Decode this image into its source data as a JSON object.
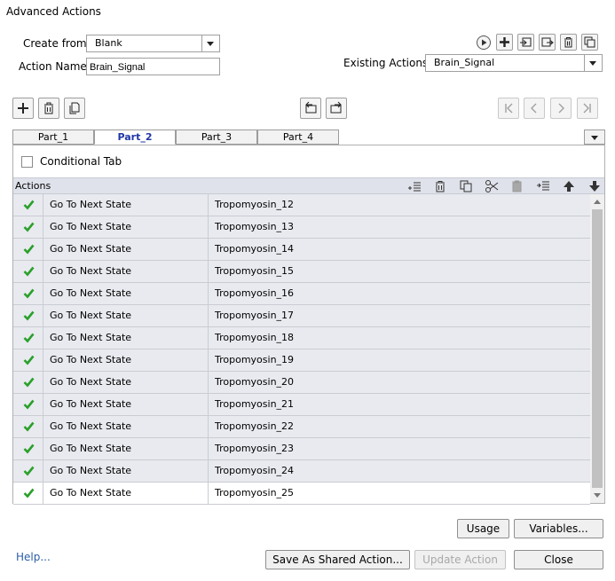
{
  "window": {
    "title": "Advanced Actions"
  },
  "form": {
    "create_from_label": "Create from:",
    "create_from_value": "Blank",
    "action_name_label": "Action Name:",
    "action_name_value": "Brain_Signal",
    "existing_actions_label": "Existing Actions:",
    "existing_actions_value": "Brain_Signal"
  },
  "tabs": [
    {
      "label": "Part_1",
      "active": false
    },
    {
      "label": "Part_2",
      "active": true
    },
    {
      "label": "Part_3",
      "active": false
    },
    {
      "label": "Part_4",
      "active": false
    }
  ],
  "conditional_tab_label": "Conditional Tab",
  "conditional_tab_checked": false,
  "actions_header": "Actions",
  "rows": [
    {
      "action": "Go To Next State",
      "target": "Tropomyosin_12"
    },
    {
      "action": "Go To Next State",
      "target": "Tropomyosin_13"
    },
    {
      "action": "Go To Next State",
      "target": "Tropomyosin_14"
    },
    {
      "action": "Go To Next State",
      "target": "Tropomyosin_15"
    },
    {
      "action": "Go To Next State",
      "target": "Tropomyosin_16"
    },
    {
      "action": "Go To Next State",
      "target": "Tropomyosin_17"
    },
    {
      "action": "Go To Next State",
      "target": "Tropomyosin_18"
    },
    {
      "action": "Go To Next State",
      "target": "Tropomyosin_19"
    },
    {
      "action": "Go To Next State",
      "target": "Tropomyosin_20"
    },
    {
      "action": "Go To Next State",
      "target": "Tropomyosin_21"
    },
    {
      "action": "Go To Next State",
      "target": "Tropomyosin_22"
    },
    {
      "action": "Go To Next State",
      "target": "Tropomyosin_23"
    },
    {
      "action": "Go To Next State",
      "target": "Tropomyosin_24"
    },
    {
      "action": "Go To Next State",
      "target": "Tropomyosin_25"
    }
  ],
  "buttons": {
    "usage": "Usage",
    "variables": "Variables...",
    "save_shared": "Save As Shared Action...",
    "update_action": "Update Action",
    "close": "Close"
  },
  "help_link": "Help...",
  "colors": {
    "accent": "#1f36a8",
    "check": "#2aa02a",
    "link": "#2b5ea8"
  },
  "icons": {
    "top_toolbar": [
      "play-icon",
      "add-icon",
      "import-icon",
      "export-icon",
      "delete-icon",
      "duplicate-icon"
    ],
    "left_toolbar": [
      "add-icon",
      "delete-icon",
      "duplicate-icon"
    ],
    "center_toolbar": [
      "import-icon",
      "export-icon"
    ],
    "nav_toolbar": [
      "first-icon",
      "previous-icon",
      "next-icon",
      "last-icon"
    ],
    "actions_header": [
      "insert-icon",
      "delete-icon",
      "copy-icon",
      "cut-icon",
      "paste-icon",
      "insert-below-icon",
      "move-up-icon",
      "move-down-icon"
    ],
    "row_status": "check-icon"
  }
}
